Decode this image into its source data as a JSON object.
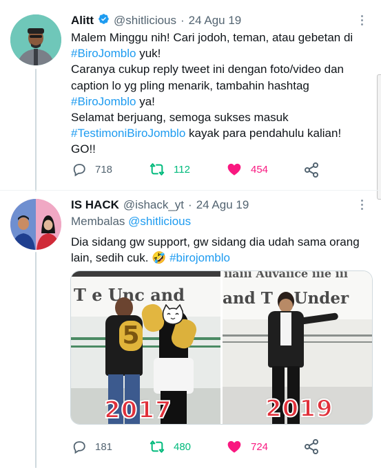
{
  "tweet1": {
    "name": "Alitt",
    "handle": "@shitlicious",
    "separator": "·",
    "date": "24 Agu 19",
    "lines": [
      [
        "Malem Minggu nih! Cari jodoh, teman, atau gebetan di"
      ],
      [
        "#BiroJomblo",
        " yuk!"
      ],
      [
        "Caranya cukup reply tweet ini dengan foto/video dan"
      ],
      [
        "caption lo yg pling menarik, tambahin hashtag"
      ],
      [
        "#BiroJomblo",
        " ya!"
      ],
      [
        "Selamat berjuang, semoga sukses masuk"
      ],
      [
        "#TestimoniBiroJomblo",
        " kayak para pendahulu kalian!"
      ],
      [
        "GO!!"
      ]
    ],
    "line_tags": [
      [
        false
      ],
      [
        true,
        false
      ],
      [
        false
      ],
      [
        false
      ],
      [
        true,
        false
      ],
      [
        false
      ],
      [
        true,
        false
      ],
      [
        false
      ]
    ],
    "replies": "718",
    "retweets": "112",
    "likes": "454"
  },
  "tweet2": {
    "name": "IS HACK",
    "handle": "@ishack_yt",
    "separator": "·",
    "date": "24 Agu 19",
    "replying_prefix": "Membalas",
    "replying_to": "@shitlicious",
    "lines": [
      [
        "Dia sidang gw support, gw sidang dia udah sama orang"
      ],
      [
        "lain, sedih cuk. ",
        "🤣",
        " ",
        "#birojomblo"
      ]
    ],
    "media": {
      "left_caption": "2017",
      "right_caption": "2019",
      "left_banner": "T  e  Unc  and",
      "right_banner_top": "iiaiii Auvaiice iiie iii",
      "right_banner": "and  T  e  Under"
    },
    "replies": "181",
    "retweets": "480",
    "likes": "724"
  },
  "colors": {
    "link": "#1d9bf0",
    "muted": "#536471",
    "like": "#f91880",
    "retweet": "#00ba7c",
    "verified": "#1d9bf0",
    "year_text": "#e0303a"
  },
  "icons": [
    "verified-icon",
    "more-icon",
    "reply-icon",
    "retweet-icon",
    "like-icon",
    "share-icon",
    "face-sticker-icon"
  ]
}
